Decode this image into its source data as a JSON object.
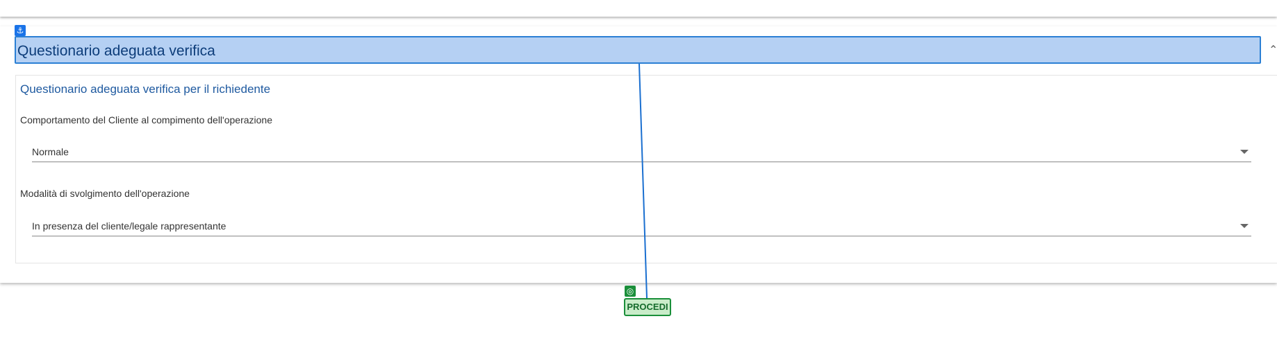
{
  "section": {
    "anchor_icon": "anchor-icon",
    "title": "Questionario adeguata verifica",
    "collapse_icon": "chevron-up-icon"
  },
  "subsection": {
    "title": "Questionario adeguata verifica per il richiedente"
  },
  "fields": [
    {
      "label": "Comportamento del Cliente al compimento dell'operazione",
      "value": "Normale"
    },
    {
      "label": "Modalità di svolgimento dell'operazione",
      "value": "In presenza del cliente/legale rappresentante"
    }
  ],
  "action": {
    "target_icon": "target-icon",
    "label": "PROCEDI"
  },
  "colors": {
    "header_bg": "#b5d0f3",
    "header_border": "#2a7fd4",
    "button_bg": "#c9ecc9",
    "button_border": "#1a8f3a"
  }
}
